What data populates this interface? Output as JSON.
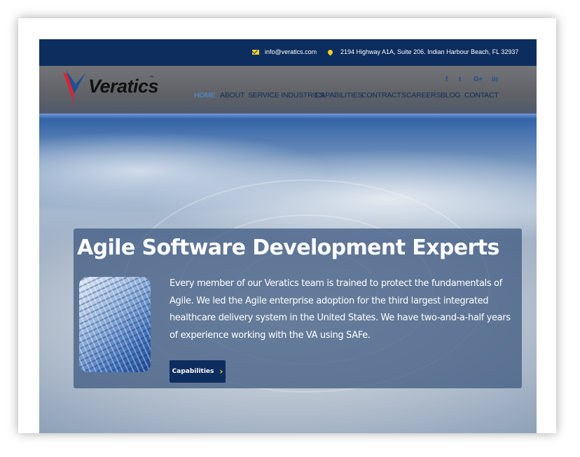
{
  "topbar": {
    "email": "info@veratics.com",
    "address": "2194 Highway A1A, Suite 206. Indian Harbour Beach, FL 32937"
  },
  "brand": {
    "name": "Veratics",
    "trademark": "™"
  },
  "social": [
    "f",
    "t",
    "G+",
    "in"
  ],
  "nav": [
    {
      "label": "HOME"
    },
    {
      "label": "ABOUT"
    },
    {
      "label": "SERVICE INDUSTRIES"
    },
    {
      "label": "CAPABILITIES"
    },
    {
      "label": "CONTRACTS"
    },
    {
      "label": "CAREERS"
    },
    {
      "label": "BLOG"
    },
    {
      "label": "CONTACT"
    }
  ],
  "hero": {
    "title": "Agile Software Development Experts",
    "body": "Every member of our Veratics team is trained to protect the fundamentals of Agile. We led the Agile enterprise adoption for the third largest integrated healthcare delivery system in the United States. We have two-and-a-half years of experience working with the VA using SAFe.",
    "button_label": "Capabilities",
    "button_icon": "chevron-right-icon"
  },
  "colors": {
    "topbar": "#0d2d5e",
    "nav_text": "#0d2d5e",
    "nav_active": "#4a90e2",
    "accent_yellow": "#f2d12e",
    "logo_red": "#e0222a",
    "logo_blue": "#1e4f99"
  }
}
